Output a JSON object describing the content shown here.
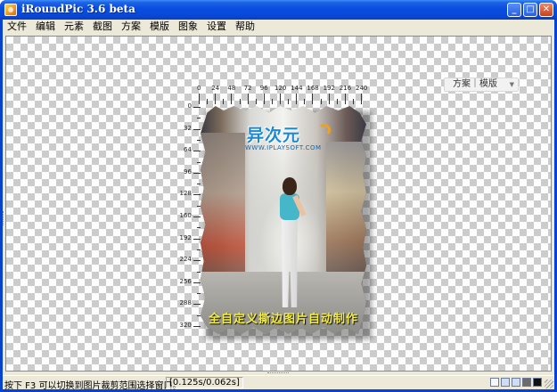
{
  "window": {
    "title": "iRoundPic 3.6 beta",
    "minimize_glyph": "_",
    "maximize_glyph": "□",
    "close_glyph": "✕"
  },
  "menu": [
    "文件",
    "编辑",
    "元素",
    "截图",
    "方案",
    "模版",
    "图象",
    "设置",
    "帮助"
  ],
  "canvas": {
    "scheme_dropdown_label": "方案｜模版",
    "ruler_h": [
      "0",
      "24",
      "48",
      "72",
      "96",
      "120",
      "144",
      "168",
      "192",
      "216",
      "240"
    ],
    "ruler_v": [
      "0",
      "32",
      "64",
      "96",
      "128",
      "160",
      "192",
      "224",
      "256",
      "288",
      "320"
    ],
    "photo": {
      "logo_text": "异次元",
      "logo_url": "WWW.IPLAYSOFT.COM",
      "caption": "全自定义撕边图片自动制作"
    }
  },
  "status": {
    "hint": "按下 F3 可以切换到图片裁剪范围选择窗口。",
    "timing": "[0.125s/0.062s]"
  },
  "colors": {
    "titlebar": "#0a4fe0",
    "chrome": "#ece9d8",
    "caption": "#f5ee3c",
    "logo": "#1d8ad0"
  }
}
